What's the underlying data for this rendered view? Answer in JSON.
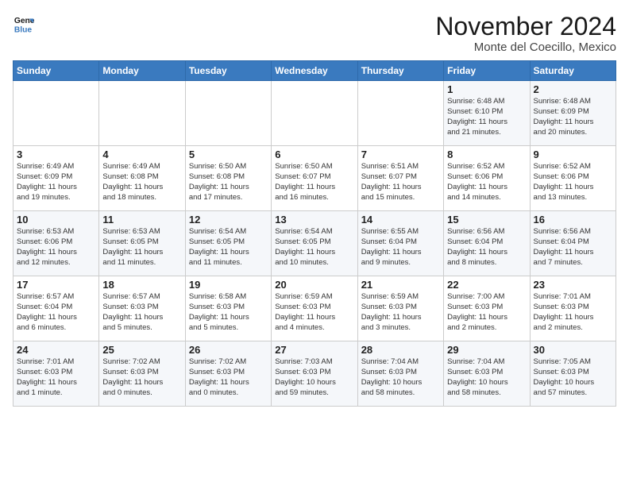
{
  "header": {
    "logo_line1": "General",
    "logo_line2": "Blue",
    "title": "November 2024",
    "subtitle": "Monte del Coecillo, Mexico"
  },
  "days_of_week": [
    "Sunday",
    "Monday",
    "Tuesday",
    "Wednesday",
    "Thursday",
    "Friday",
    "Saturday"
  ],
  "weeks": [
    [
      {
        "day": "",
        "info": ""
      },
      {
        "day": "",
        "info": ""
      },
      {
        "day": "",
        "info": ""
      },
      {
        "day": "",
        "info": ""
      },
      {
        "day": "",
        "info": ""
      },
      {
        "day": "1",
        "info": "Sunrise: 6:48 AM\nSunset: 6:10 PM\nDaylight: 11 hours\nand 21 minutes."
      },
      {
        "day": "2",
        "info": "Sunrise: 6:48 AM\nSunset: 6:09 PM\nDaylight: 11 hours\nand 20 minutes."
      }
    ],
    [
      {
        "day": "3",
        "info": "Sunrise: 6:49 AM\nSunset: 6:09 PM\nDaylight: 11 hours\nand 19 minutes."
      },
      {
        "day": "4",
        "info": "Sunrise: 6:49 AM\nSunset: 6:08 PM\nDaylight: 11 hours\nand 18 minutes."
      },
      {
        "day": "5",
        "info": "Sunrise: 6:50 AM\nSunset: 6:08 PM\nDaylight: 11 hours\nand 17 minutes."
      },
      {
        "day": "6",
        "info": "Sunrise: 6:50 AM\nSunset: 6:07 PM\nDaylight: 11 hours\nand 16 minutes."
      },
      {
        "day": "7",
        "info": "Sunrise: 6:51 AM\nSunset: 6:07 PM\nDaylight: 11 hours\nand 15 minutes."
      },
      {
        "day": "8",
        "info": "Sunrise: 6:52 AM\nSunset: 6:06 PM\nDaylight: 11 hours\nand 14 minutes."
      },
      {
        "day": "9",
        "info": "Sunrise: 6:52 AM\nSunset: 6:06 PM\nDaylight: 11 hours\nand 13 minutes."
      }
    ],
    [
      {
        "day": "10",
        "info": "Sunrise: 6:53 AM\nSunset: 6:06 PM\nDaylight: 11 hours\nand 12 minutes."
      },
      {
        "day": "11",
        "info": "Sunrise: 6:53 AM\nSunset: 6:05 PM\nDaylight: 11 hours\nand 11 minutes."
      },
      {
        "day": "12",
        "info": "Sunrise: 6:54 AM\nSunset: 6:05 PM\nDaylight: 11 hours\nand 11 minutes."
      },
      {
        "day": "13",
        "info": "Sunrise: 6:54 AM\nSunset: 6:05 PM\nDaylight: 11 hours\nand 10 minutes."
      },
      {
        "day": "14",
        "info": "Sunrise: 6:55 AM\nSunset: 6:04 PM\nDaylight: 11 hours\nand 9 minutes."
      },
      {
        "day": "15",
        "info": "Sunrise: 6:56 AM\nSunset: 6:04 PM\nDaylight: 11 hours\nand 8 minutes."
      },
      {
        "day": "16",
        "info": "Sunrise: 6:56 AM\nSunset: 6:04 PM\nDaylight: 11 hours\nand 7 minutes."
      }
    ],
    [
      {
        "day": "17",
        "info": "Sunrise: 6:57 AM\nSunset: 6:04 PM\nDaylight: 11 hours\nand 6 minutes."
      },
      {
        "day": "18",
        "info": "Sunrise: 6:57 AM\nSunset: 6:03 PM\nDaylight: 11 hours\nand 5 minutes."
      },
      {
        "day": "19",
        "info": "Sunrise: 6:58 AM\nSunset: 6:03 PM\nDaylight: 11 hours\nand 5 minutes."
      },
      {
        "day": "20",
        "info": "Sunrise: 6:59 AM\nSunset: 6:03 PM\nDaylight: 11 hours\nand 4 minutes."
      },
      {
        "day": "21",
        "info": "Sunrise: 6:59 AM\nSunset: 6:03 PM\nDaylight: 11 hours\nand 3 minutes."
      },
      {
        "day": "22",
        "info": "Sunrise: 7:00 AM\nSunset: 6:03 PM\nDaylight: 11 hours\nand 2 minutes."
      },
      {
        "day": "23",
        "info": "Sunrise: 7:01 AM\nSunset: 6:03 PM\nDaylight: 11 hours\nand 2 minutes."
      }
    ],
    [
      {
        "day": "24",
        "info": "Sunrise: 7:01 AM\nSunset: 6:03 PM\nDaylight: 11 hours\nand 1 minute."
      },
      {
        "day": "25",
        "info": "Sunrise: 7:02 AM\nSunset: 6:03 PM\nDaylight: 11 hours\nand 0 minutes."
      },
      {
        "day": "26",
        "info": "Sunrise: 7:02 AM\nSunset: 6:03 PM\nDaylight: 11 hours\nand 0 minutes."
      },
      {
        "day": "27",
        "info": "Sunrise: 7:03 AM\nSunset: 6:03 PM\nDaylight: 10 hours\nand 59 minutes."
      },
      {
        "day": "28",
        "info": "Sunrise: 7:04 AM\nSunset: 6:03 PM\nDaylight: 10 hours\nand 58 minutes."
      },
      {
        "day": "29",
        "info": "Sunrise: 7:04 AM\nSunset: 6:03 PM\nDaylight: 10 hours\nand 58 minutes."
      },
      {
        "day": "30",
        "info": "Sunrise: 7:05 AM\nSunset: 6:03 PM\nDaylight: 10 hours\nand 57 minutes."
      }
    ]
  ]
}
